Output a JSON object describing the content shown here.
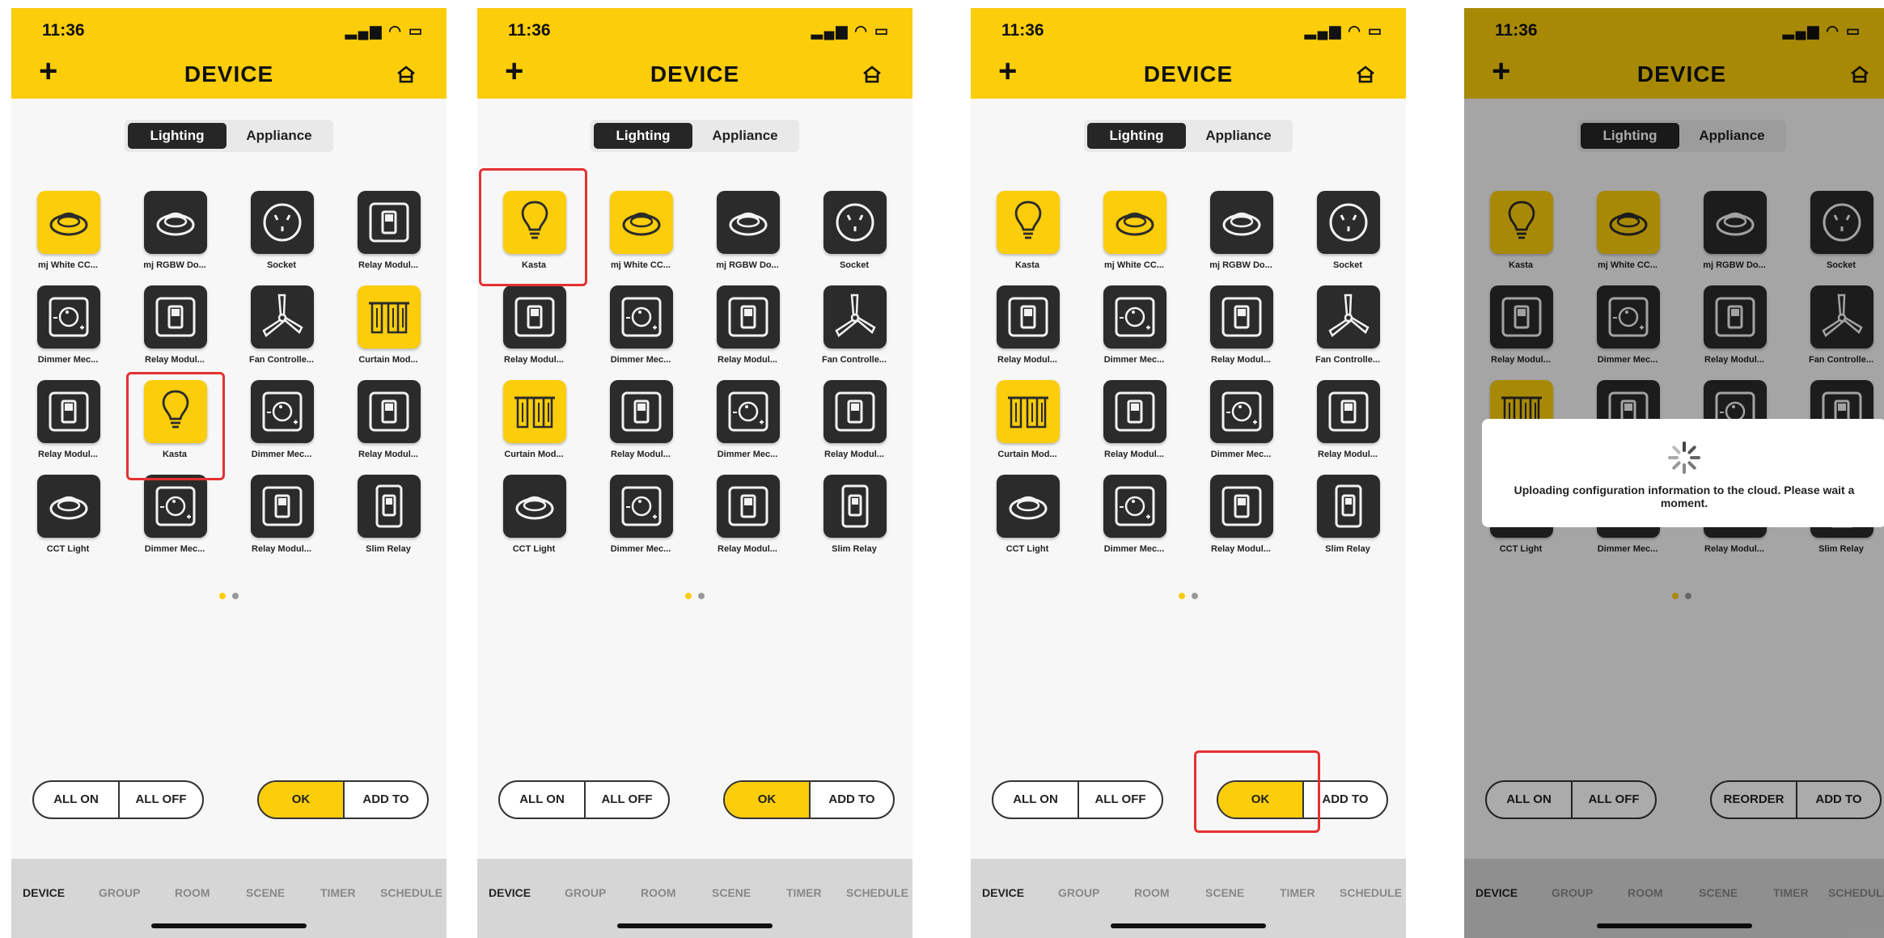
{
  "status_time": "11:36",
  "header_title": "DEVICE",
  "seg": {
    "lighting": "Lighting",
    "appliance": "Appliance"
  },
  "tabs": [
    "DEVICE",
    "GROUP",
    "ROOM",
    "SCENE",
    "TIMER",
    "SCHEDULE"
  ],
  "colors": {
    "accent": "#fbcd0a",
    "tile": "#2b2b2b",
    "highlight": "#e53131"
  },
  "panel1": {
    "devices": [
      {
        "label": "mj White CC...",
        "icon": "downlight-icon",
        "on": true
      },
      {
        "label": "mj RGBW Do...",
        "icon": "downlight-icon",
        "on": false
      },
      {
        "label": "Socket",
        "icon": "socket-icon",
        "on": false
      },
      {
        "label": "Relay Modul...",
        "icon": "relay-switch-icon",
        "on": false
      },
      {
        "label": "Dimmer Mec...",
        "icon": "dimmer-icon",
        "on": false
      },
      {
        "label": "Relay Modul...",
        "icon": "relay-switch-icon",
        "on": false
      },
      {
        "label": "Fan Controlle...",
        "icon": "fan-icon",
        "on": false
      },
      {
        "label": "Curtain Mod...",
        "icon": "curtain-icon",
        "on": true
      },
      {
        "label": "Relay Modul...",
        "icon": "relay-switch-icon",
        "on": false
      },
      {
        "label": "Kasta",
        "icon": "bulb-icon",
        "on": true
      },
      {
        "label": "Dimmer Mec...",
        "icon": "dimmer-icon",
        "on": false
      },
      {
        "label": "Relay Modul...",
        "icon": "relay-switch-icon",
        "on": false
      },
      {
        "label": "CCT Light",
        "icon": "downlight-icon",
        "on": false
      },
      {
        "label": "Dimmer Mec...",
        "icon": "dimmer-icon",
        "on": false
      },
      {
        "label": "Relay Modul...",
        "icon": "relay-switch-icon",
        "on": false
      },
      {
        "label": "Slim Relay",
        "icon": "slim-relay-icon",
        "on": false
      }
    ],
    "buttons": {
      "all_on": "ALL ON",
      "all_off": "ALL OFF",
      "primary": "OK",
      "add_to": "ADD TO"
    }
  },
  "panel2": {
    "devices": [
      {
        "label": "Kasta",
        "icon": "bulb-icon",
        "on": true
      },
      {
        "label": "mj White CC...",
        "icon": "downlight-icon",
        "on": true
      },
      {
        "label": "mj RGBW Do...",
        "icon": "downlight-icon",
        "on": false
      },
      {
        "label": "Socket",
        "icon": "socket-icon",
        "on": false
      },
      {
        "label": "Relay Modul...",
        "icon": "relay-switch-icon",
        "on": false
      },
      {
        "label": "Dimmer Mec...",
        "icon": "dimmer-icon",
        "on": false
      },
      {
        "label": "Relay Modul...",
        "icon": "relay-switch-icon",
        "on": false
      },
      {
        "label": "Fan Controlle...",
        "icon": "fan-icon",
        "on": false
      },
      {
        "label": "Curtain Mod...",
        "icon": "curtain-icon",
        "on": true
      },
      {
        "label": "Relay Modul...",
        "icon": "relay-switch-icon",
        "on": false
      },
      {
        "label": "Dimmer Mec...",
        "icon": "dimmer-icon",
        "on": false
      },
      {
        "label": "Relay Modul...",
        "icon": "relay-switch-icon",
        "on": false
      },
      {
        "label": "CCT Light",
        "icon": "downlight-icon",
        "on": false
      },
      {
        "label": "Dimmer Mec...",
        "icon": "dimmer-icon",
        "on": false
      },
      {
        "label": "Relay Modul...",
        "icon": "relay-switch-icon",
        "on": false
      },
      {
        "label": "Slim Relay",
        "icon": "slim-relay-icon",
        "on": false
      }
    ],
    "buttons": {
      "all_on": "ALL ON",
      "all_off": "ALL OFF",
      "primary": "OK",
      "add_to": "ADD TO"
    }
  },
  "panel3": {
    "devices": [
      {
        "label": "Kasta",
        "icon": "bulb-icon",
        "on": true
      },
      {
        "label": "mj White CC...",
        "icon": "downlight-icon",
        "on": true
      },
      {
        "label": "mj RGBW Do...",
        "icon": "downlight-icon",
        "on": false
      },
      {
        "label": "Socket",
        "icon": "socket-icon",
        "on": false
      },
      {
        "label": "Relay Modul...",
        "icon": "relay-switch-icon",
        "on": false
      },
      {
        "label": "Dimmer Mec...",
        "icon": "dimmer-icon",
        "on": false
      },
      {
        "label": "Relay Modul...",
        "icon": "relay-switch-icon",
        "on": false
      },
      {
        "label": "Fan Controlle...",
        "icon": "fan-icon",
        "on": false
      },
      {
        "label": "Curtain Mod...",
        "icon": "curtain-icon",
        "on": true
      },
      {
        "label": "Relay Modul...",
        "icon": "relay-switch-icon",
        "on": false
      },
      {
        "label": "Dimmer Mec...",
        "icon": "dimmer-icon",
        "on": false
      },
      {
        "label": "Relay Modul...",
        "icon": "relay-switch-icon",
        "on": false
      },
      {
        "label": "CCT Light",
        "icon": "downlight-icon",
        "on": false
      },
      {
        "label": "Dimmer Mec...",
        "icon": "dimmer-icon",
        "on": false
      },
      {
        "label": "Relay Modul...",
        "icon": "relay-switch-icon",
        "on": false
      },
      {
        "label": "Slim Relay",
        "icon": "slim-relay-icon",
        "on": false
      }
    ],
    "buttons": {
      "all_on": "ALL ON",
      "all_off": "ALL OFF",
      "primary": "OK",
      "add_to": "ADD TO"
    }
  },
  "panel4": {
    "devices": [
      {
        "label": "Kasta",
        "icon": "bulb-icon",
        "on": true
      },
      {
        "label": "mj White CC...",
        "icon": "downlight-icon",
        "on": true
      },
      {
        "label": "mj RGBW Do...",
        "icon": "downlight-icon",
        "on": false
      },
      {
        "label": "Socket",
        "icon": "socket-icon",
        "on": false
      },
      {
        "label": "Relay Modul...",
        "icon": "relay-switch-icon",
        "on": false
      },
      {
        "label": "Dimmer Mec...",
        "icon": "dimmer-icon",
        "on": false
      },
      {
        "label": "Relay Modul...",
        "icon": "relay-switch-icon",
        "on": false
      },
      {
        "label": "Fan Controlle...",
        "icon": "fan-icon",
        "on": false
      },
      {
        "label": "",
        "icon": "curtain-icon",
        "on": true
      },
      {
        "label": "",
        "icon": "relay-switch-icon",
        "on": false
      },
      {
        "label": "",
        "icon": "dimmer-icon",
        "on": false
      },
      {
        "label": "",
        "icon": "relay-switch-icon",
        "on": false
      },
      {
        "label": "CCT Light",
        "icon": "downlight-icon",
        "on": false
      },
      {
        "label": "Dimmer Mec...",
        "icon": "dimmer-icon",
        "on": false
      },
      {
        "label": "Relay Modul...",
        "icon": "relay-switch-icon",
        "on": false
      },
      {
        "label": "Slim Relay",
        "icon": "slim-relay-icon",
        "on": false
      }
    ],
    "buttons": {
      "all_on": "ALL ON",
      "all_off": "ALL OFF",
      "primary": "REORDER",
      "add_to": "ADD TO"
    },
    "dialog_message": "Uploading configuration information to the cloud. Please wait a moment."
  }
}
